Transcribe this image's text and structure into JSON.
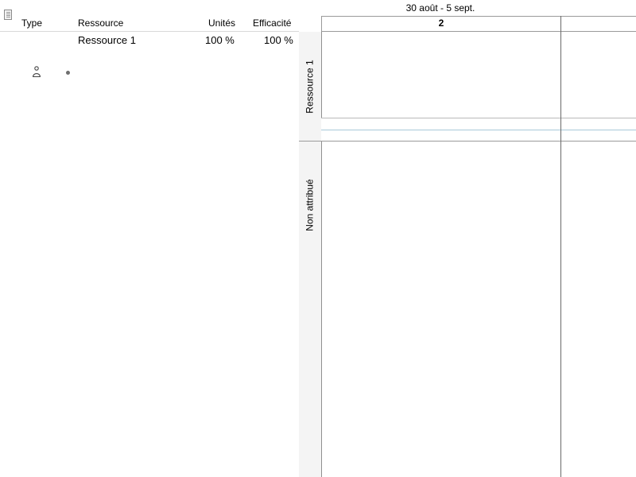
{
  "table": {
    "columns": {
      "type": "Type",
      "resource": "Ressource",
      "units": "Unités",
      "efficiency": "Efficacité"
    },
    "rows": [
      {
        "type_icon": "person-icon",
        "bullet_icon": "bullet-icon",
        "resource": "Ressource 1",
        "units": "100 %",
        "efficiency": "100 %"
      }
    ]
  },
  "timeline": {
    "week_range": "30 août - 5 sept.",
    "week_number": "2"
  },
  "lanes": [
    {
      "label": "Ressource 1"
    },
    {
      "label": "Non attribué"
    }
  ],
  "icons": {
    "header_icon": "document-icon"
  },
  "colors": {
    "grid_line": "#9a9a9a",
    "lane_gutter": "#f4f4f4",
    "lane_separator_blue": "#a9c8d9"
  }
}
